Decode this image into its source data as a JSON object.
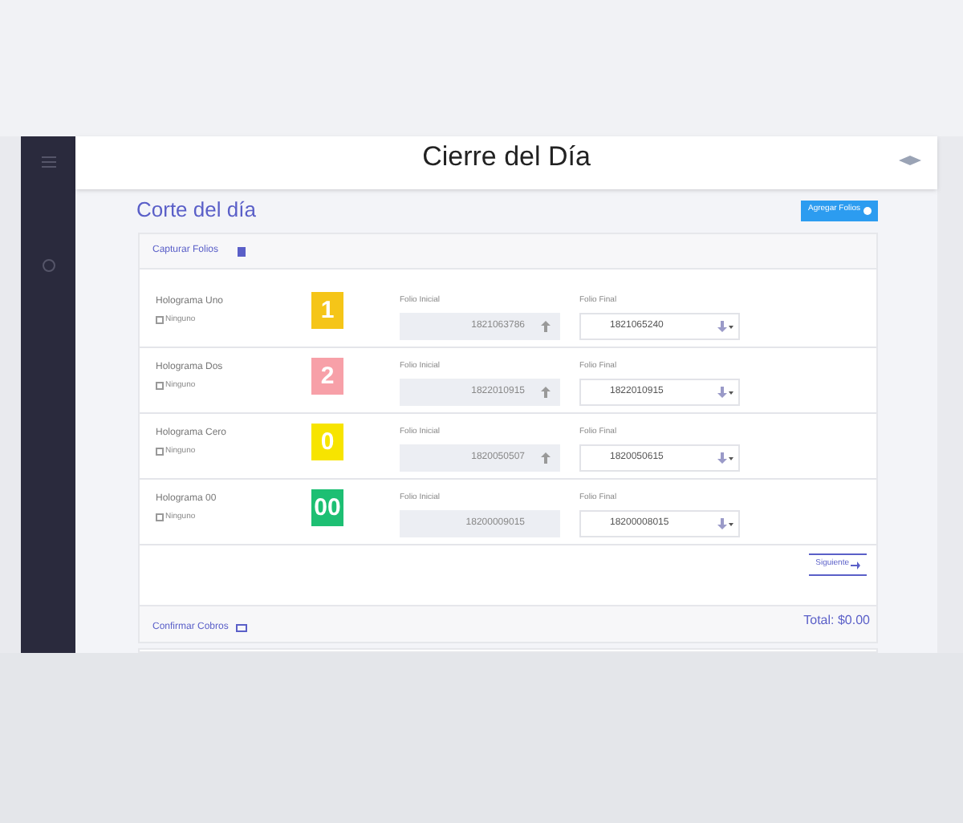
{
  "header": {
    "title": "Cierre del Día"
  },
  "page": {
    "title": "Corte del día",
    "add_button": "Agregar Folios"
  },
  "capture": {
    "title": "Capturar Folios",
    "rows": [
      {
        "name": "Holograma Uno",
        "option": "Ninguno",
        "checked": false,
        "badge": "1",
        "color": "#f5c518",
        "inicial_label": "Folio Inicial",
        "inicial": "1821063786",
        "inicial_arrow": true,
        "final_label": "Folio Final",
        "final": "1821065240"
      },
      {
        "name": "Holograma Dos",
        "option": "Ninguno",
        "checked": false,
        "badge": "2",
        "color": "#f7a0a8",
        "inicial_label": "Folio Inicial",
        "inicial": "1822010915",
        "inicial_arrow": true,
        "final_label": "Folio Final",
        "final": "1822010915"
      },
      {
        "name": "Holograma Cero",
        "option": "Ninguno",
        "checked": false,
        "badge": "0",
        "color": "#f7e400",
        "inicial_label": "Folio Inicial",
        "inicial": "1820050507",
        "inicial_arrow": true,
        "final_label": "Folio Final",
        "final": "1820050615"
      },
      {
        "name": "Holograma 00",
        "option": "Ninguno",
        "checked": false,
        "badge": "00",
        "color": "#1dbf73",
        "inicial_label": "Folio Inicial",
        "inicial": "18200009015",
        "inicial_arrow": false,
        "final_label": "Folio Final",
        "final": "18200008015"
      }
    ],
    "next_button": "Siguiente"
  },
  "payments": {
    "title": "Confirmar Cobros",
    "total": "Total: $0.00"
  }
}
